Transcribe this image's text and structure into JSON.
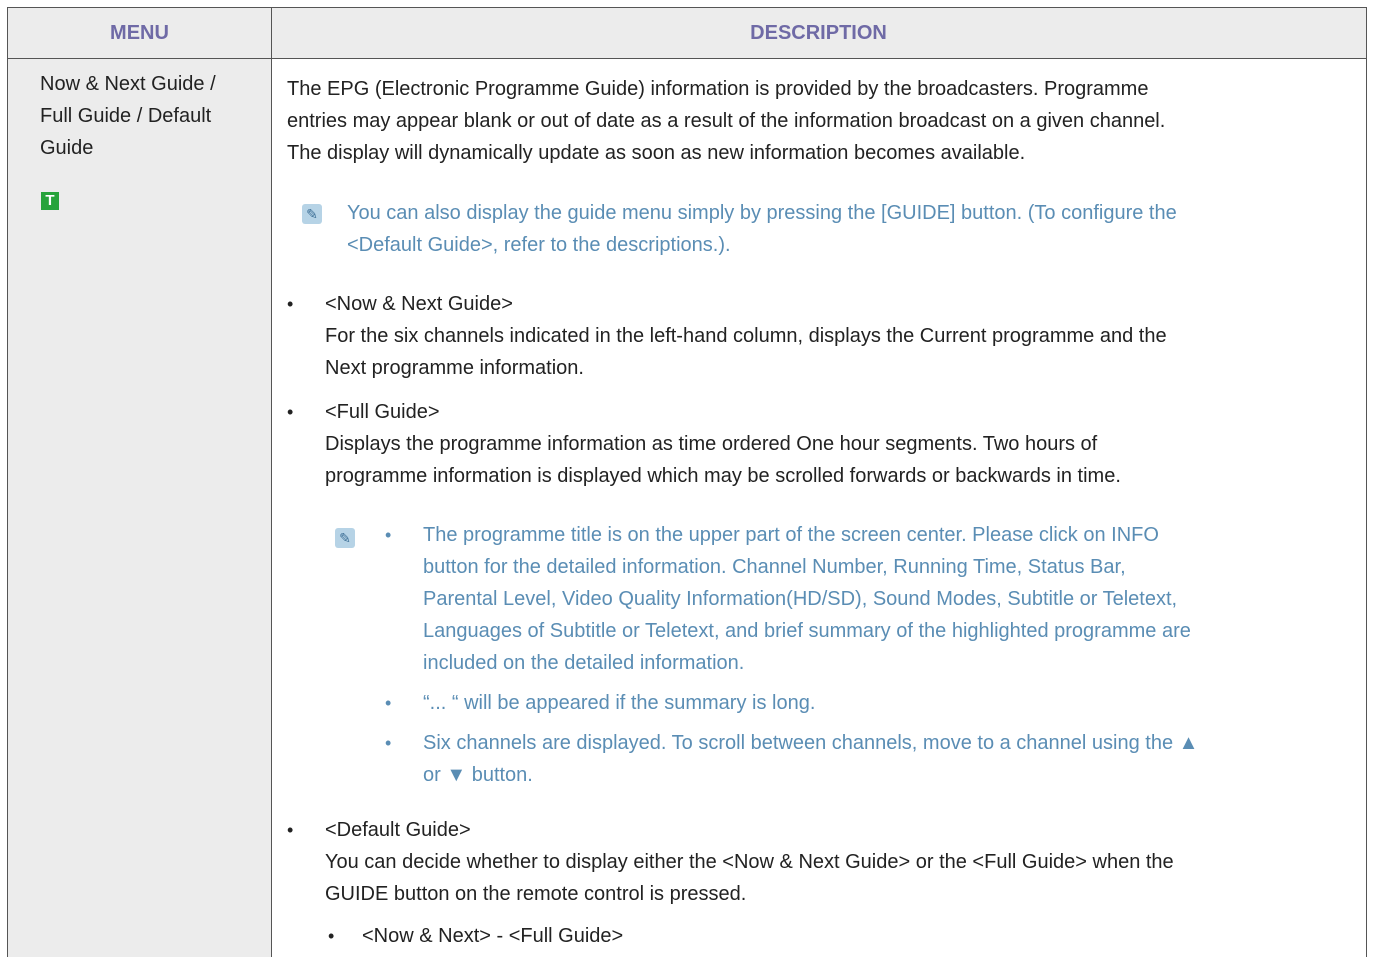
{
  "table": {
    "header": {
      "menu": "MENU",
      "description": "DESCRIPTION"
    },
    "menu_item": {
      "lines": [
        "Now & Next Guide /",
        "Full Guide / Default",
        "Guide"
      ],
      "tag": "T"
    },
    "intro_lines": [
      "The EPG (Electronic Programme Guide) information is provided by the broadcasters. Programme",
      "entries may appear blank or out of date as a result of the information broadcast on a given channel.",
      "The display will dynamically update as soon as new information becomes available."
    ],
    "note1_lines": [
      "You can also display the guide menu simply by pressing the [GUIDE] button. (To configure the",
      "<Default Guide>, refer to the descriptions.)."
    ],
    "now_next": {
      "title": "<Now & Next Guide>",
      "lines": [
        "For the six channels indicated in the left-hand column, displays the Current programme and the",
        "Next programme information."
      ]
    },
    "full_guide": {
      "title": "<Full Guide>",
      "lines": [
        "Displays the programme information as time ordered One hour segments. Two hours of",
        "programme information is displayed which may be scrolled forwards or backwards in time."
      ]
    },
    "notes2": {
      "item1_lines": [
        "The programme title is on the upper part of the screen center. Please click on INFO",
        "button for the detailed information. Channel Number, Running Time, Status Bar,",
        "Parental Level, Video Quality Information(HD/SD), Sound Modes, Subtitle or Teletext,",
        "Languages of Subtitle or Teletext, and brief summary of the highlighted programme are",
        "included on the detailed information."
      ],
      "item2": "“... “ will be appeared if the summary is long.",
      "item3_lines": [
        "Six channels are displayed. To scroll between channels, move to a channel using the ▲",
        "or ▼ button."
      ]
    },
    "default_guide": {
      "title": "<Default Guide>",
      "lines": [
        "You can decide whether to display either the <Now & Next Guide> or the <Full Guide> when the",
        "GUIDE button on the remote control is pressed."
      ],
      "sub_item": "<Now & Next> - <Full Guide>"
    },
    "bullet_char": "•",
    "colors": {
      "header_text": "#6f6aa6",
      "note_text": "#5a8db4",
      "tag_bg": "#27a33b",
      "cell_bg": "#ececec"
    },
    "icons": {
      "note": "note-icon",
      "tag": "tv-mode-icon"
    }
  }
}
